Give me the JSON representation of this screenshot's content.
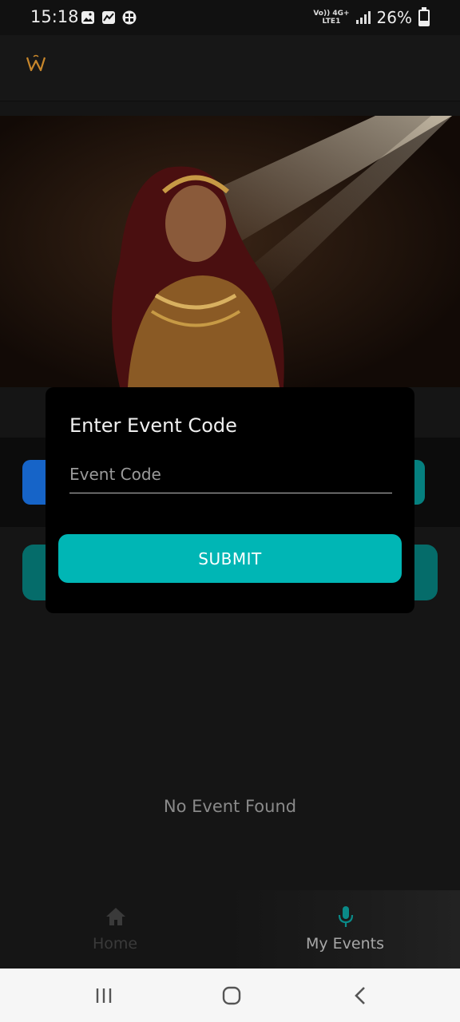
{
  "status_bar": {
    "time": "15:18",
    "network_top": "Vo)) 4G+",
    "network_bottom": "LTE1",
    "battery_percent": "26%",
    "battery_level": 0.26
  },
  "app_bar": {
    "logo_icon": "wedding-w-logo"
  },
  "page": {
    "empty_message": "No Event Found"
  },
  "dialog": {
    "title": "Enter Event Code",
    "input_placeholder": "Event Code",
    "input_value": "",
    "submit_label": "SUBMIT"
  },
  "bottom_nav": {
    "items": [
      {
        "label": "Home",
        "icon": "home-icon",
        "active": false
      },
      {
        "label": "My Events",
        "icon": "mic-icon",
        "active": true
      }
    ]
  },
  "colors": {
    "accent": "#00b6b5",
    "background": "#151515",
    "dialog": "#000000",
    "facebook": "#1664c8"
  }
}
